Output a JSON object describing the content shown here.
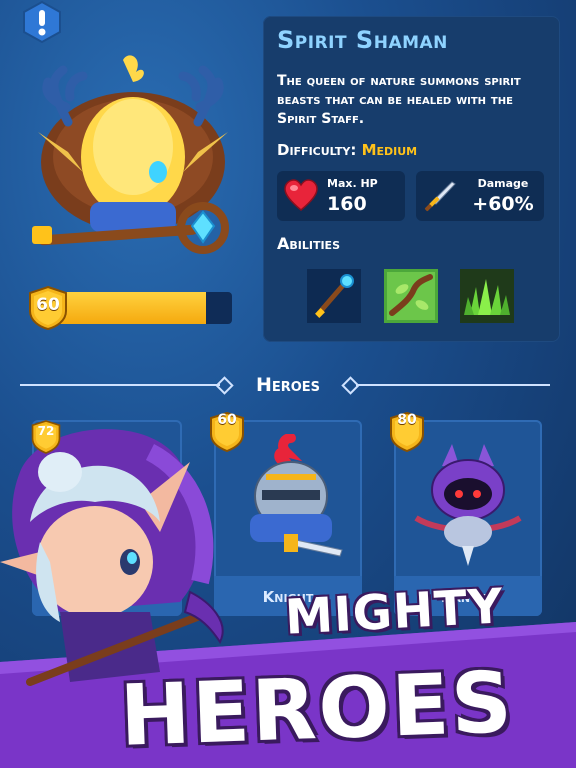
{
  "hero": {
    "name": "Spirit Shaman",
    "description": "The queen of nature summons spirit beasts that can be healed with the Spirit Staff.",
    "difficulty_label": "Difficulty:",
    "difficulty_value": "Medium",
    "level": "60",
    "level_progress": 0.86
  },
  "stats": {
    "hp_label": "Max. HP",
    "hp_value": "160",
    "hp_icon": "heart-icon",
    "damage_label": "Damage",
    "damage_value": "+60%",
    "damage_icon": "sword-icon"
  },
  "abilities": {
    "title": "Abilities",
    "items": [
      {
        "icon": "staff-ability-icon"
      },
      {
        "icon": "vine-ability-icon"
      },
      {
        "icon": "grass-spikes-ability-icon"
      }
    ]
  },
  "heroes_section": {
    "title": "Heroes"
  },
  "cards": [
    {
      "level": "72",
      "name": ""
    },
    {
      "level": "60",
      "name": "Knight"
    },
    {
      "level": "80",
      "name": "Ranger"
    }
  ],
  "promo": {
    "line1": "MIGHTY",
    "line2": "HEROES"
  },
  "colors": {
    "accent_name": "#8fd3ff",
    "difficulty": "#ffc21a",
    "banner": "#7a35c8",
    "level_fill": "#f5b51a"
  }
}
